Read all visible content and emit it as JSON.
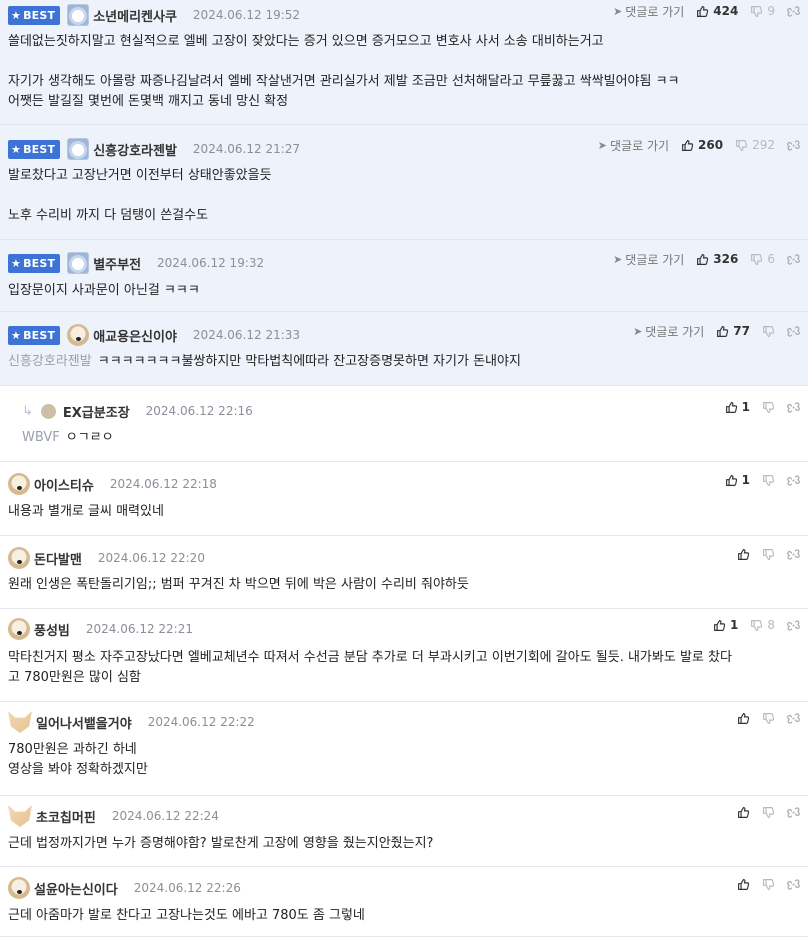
{
  "badge_label": "BEST",
  "reply_label": "댓글로 가기",
  "comments": [
    {
      "best": true,
      "avatar": "bear",
      "nick": "소년메리켄사쿠",
      "date": "2024.06.12 19:52",
      "show_reply": true,
      "likes": "424",
      "dislikes": "9",
      "lines": [
        "쓸데없는짓하지말고 현실적으로 엘베 고장이 잦았다는 증거 있으면 증거모으고 변호사 사서 소송 대비하는거고",
        "",
        "자기가 생각해도 아몰랑 짜증나김날려서 엘베 작살낸거면 관리실가서 제발 조금만 선처해달라고 무릎꿇고 싹싹빌어야됨 ㅋㅋ",
        "어쨋든 발길질 몇번에 돈몇백 깨지고 동네 망신 확정"
      ]
    },
    {
      "best": true,
      "avatar": "bear",
      "nick": "신흥강호라젠발",
      "date": "2024.06.12 21:27",
      "show_reply": true,
      "likes": "260",
      "dislikes": "292",
      "lines": [
        "발로찼다고 고장난거면 이전부터 상태안좋았을듯",
        "",
        "노후 수리비 까지 다 덤탱이 쓴걸수도"
      ]
    },
    {
      "best": true,
      "avatar": "bear",
      "nick": "별주부전",
      "date": "2024.06.12 19:32",
      "show_reply": true,
      "likes": "326",
      "dislikes": "6",
      "lines": [
        "입장문이지 사과문이 아닌걸 ㅋㅋㅋ"
      ]
    },
    {
      "best": true,
      "avatar": "dog",
      "nick": "애교용은신이야",
      "date": "2024.06.12 21:33",
      "show_reply": true,
      "likes": "77",
      "dislikes": "",
      "mention": "신흥강호라젠발",
      "lines": [
        "ㅋㅋㅋㅋㅋㅋㅋ불쌍하지만 막타법칙에따라 잔고장증명못하면 자기가 돈내야지"
      ]
    },
    {
      "best": false,
      "reply": true,
      "avatar": "dot",
      "nick": "EX급분조장",
      "date": "2024.06.12 22:16",
      "show_reply": false,
      "likes": "1",
      "dislikes": "",
      "mention": "WBVF",
      "lines": [
        "ㅇㄱㄹㅇ"
      ]
    },
    {
      "best": false,
      "avatar": "dog",
      "nick": "아이스티슈",
      "date": "2024.06.12 22:18",
      "show_reply": false,
      "likes": "1",
      "dislikes": "",
      "lines": [
        "내용과 별개로 글씨 매력있네"
      ]
    },
    {
      "best": false,
      "avatar": "dog",
      "nick": "돈다발맨",
      "date": "2024.06.12 22:20",
      "show_reply": false,
      "likes": "",
      "dislikes": "",
      "lines": [
        "원래 인생은 폭탄돌리기임;; 범퍼 꾸겨진 차 박으면 뒤에 박은 사람이 수리비 줘야하듯"
      ]
    },
    {
      "best": false,
      "avatar": "dog",
      "nick": "풍성빔",
      "date": "2024.06.12 22:21",
      "show_reply": false,
      "likes": "1",
      "dislikes": "8",
      "lines": [
        "막타친거지 평소 자주고장났다면 엘베교체년수 따져서 수선금 분담 추가로 더 부과시키고 이번기회에 갈아도 될듯. 내가봐도 발로 찼다",
        "고 780만원은 많이 심함"
      ]
    },
    {
      "best": false,
      "avatar": "fox",
      "nick": "일어나서뱉을거야",
      "date": "2024.06.12 22:22",
      "show_reply": false,
      "likes": "",
      "dislikes": "",
      "lines": [
        "780만원은 과하긴 하네",
        "영상을 봐야 정확하겠지만"
      ]
    },
    {
      "best": false,
      "avatar": "fox",
      "nick": "초코칩머핀",
      "date": "2024.06.12 22:24",
      "show_reply": false,
      "likes": "",
      "dislikes": "",
      "lines": [
        "근데 법정까지가면 누가 증명해야함? 발로찬게 고장에 영향을 줬는지안줬는지?"
      ]
    },
    {
      "best": false,
      "avatar": "dog",
      "nick": "설윤아는신이다",
      "date": "2024.06.12 22:26",
      "show_reply": false,
      "likes": "",
      "dislikes": "",
      "lines": [
        "근데 아줌마가 발로 찬다고 고장나는것도 에바고 780도 좀 그렇네"
      ]
    }
  ]
}
